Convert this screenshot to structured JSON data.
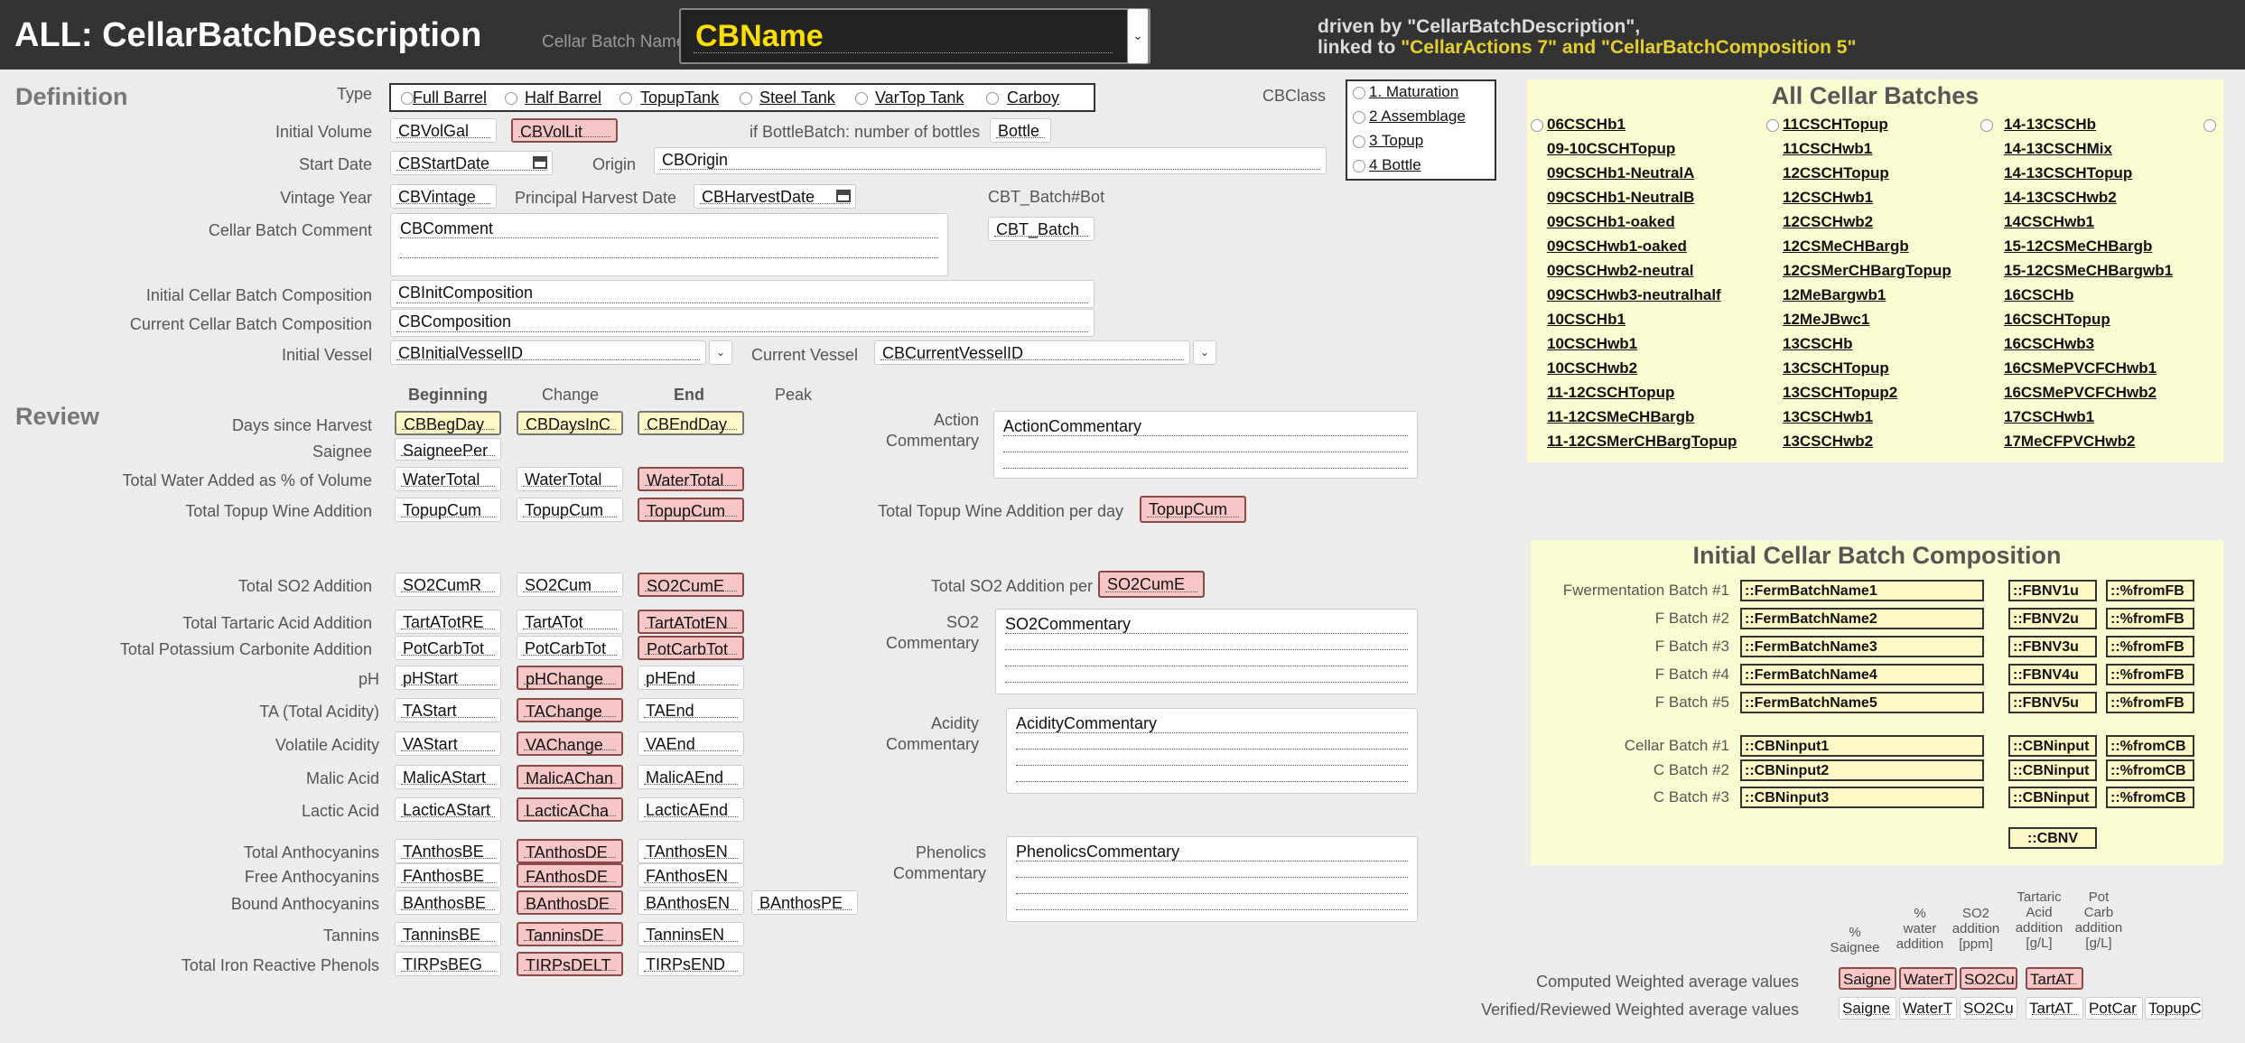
{
  "header": {
    "title": "ALL: CellarBatchDescription",
    "cbname_label": "Cellar Batch Name",
    "cbname_value": "CBName",
    "driven_line1": "driven by \"CellarBatchDescription\",",
    "driven_line2a": "linked to ",
    "driven_line2b": "\"CellarActions 7\" and \"CellarBatchComposition 5\"",
    "dropdown_glyph": "⌄"
  },
  "definition": {
    "section": "Definition",
    "type_label": "Type",
    "type_options": [
      "Full Barrel",
      "Half Barrel",
      "TopupTank",
      "Steel Tank",
      "VarTop Tank",
      "Carboy"
    ],
    "cbclass_label": "CBClass",
    "cbclass_options": [
      "1. Maturation",
      "2 Assemblage",
      "3 Topup",
      "4 Bottle"
    ],
    "initial_volume_label": "Initial Volume",
    "initial_volume_a": "CBVolGal",
    "initial_volume_b": "CBVolLit",
    "bottle_label": "if BottleBatch: number of bottles",
    "bottle_value": "Bottle",
    "start_date_label": "Start Date",
    "start_date": "CBStartDate",
    "origin_label": "Origin",
    "origin": "CBOrigin",
    "vintage_label": "Vintage Year",
    "vintage": "CBVintage",
    "harvest_label": "Principal Harvest Date",
    "harvest": "CBHarvestDate",
    "cbt_label": "CBT_Batch#Bot",
    "cbt_value": "CBT_Batch",
    "comment_label": "Cellar Batch Comment",
    "comment": "CBComment",
    "init_comp_label": "Initial Cellar Batch Composition",
    "init_comp": "CBInitComposition",
    "cur_comp_label": "Current Cellar Batch Composition",
    "cur_comp": "CBComposition",
    "init_vessel_label": "Initial Vessel",
    "init_vessel": "CBInitialVesselID",
    "cur_vessel_label": "Current Vessel",
    "cur_vessel": "CBCurrentVesselID"
  },
  "review": {
    "section": "Review",
    "col_beginning": "Beginning",
    "col_change": "Change",
    "col_end": "End",
    "col_peak": "Peak",
    "days_label": "Days since  Harvest",
    "days_beg": "CBBegDay",
    "days_chg": "CBDaysInC",
    "days_end": "CBEndDay",
    "saignee_label": "Saignee",
    "saignee": "SaigneePer",
    "water_label": "Total Water Added as % of Volume",
    "water_a": "WaterTotal",
    "water_b": "WaterTotal",
    "water_c": "WaterTotal",
    "topup_label": "Total Topup Wine Addition",
    "topup_a": "TopupCum",
    "topup_b": "TopupCum",
    "topup_c": "TopupCum",
    "topup_day_label": "Total Topup Wine Addition per day",
    "topup_day": "TopupCum",
    "action_label_1": "Action",
    "action_label_2": "Commentary",
    "action_comment": "ActionCommentary",
    "so2_label": "Total SO2 Addition",
    "so2_a": "SO2CumR",
    "so2_b": "SO2Cum",
    "so2_c": "SO2CumE",
    "so2_day_label": "Total SO2 Addition per day",
    "so2_day": "SO2CumE",
    "so2c_label_1": "SO2",
    "so2c_label_2": "Commentary",
    "so2_comment": "SO2Commentary",
    "tart_label": "Total Tartaric Acid Addition",
    "tart_a": "TartATotRE",
    "tart_b": "TartATot",
    "tart_c": "TartATotEN",
    "potc_label": "Total Potassium Carbonite Addition",
    "potc_a": "PotCarbTot",
    "potc_b": "PotCarbTot",
    "potc_c": "PotCarbTot",
    "ph_label": "pH",
    "ph_a": "pHStart",
    "ph_b": "pHChange",
    "ph_c": "pHEnd",
    "ta_label": "TA (Total Acidity)",
    "ta_a": "TAStart",
    "ta_b": "TAChange",
    "ta_c": "TAEnd",
    "va_label": "Volatile Acidity",
    "va_a": "VAStart",
    "va_b": "VAChange",
    "va_c": "VAEnd",
    "acid_label_1": "Acidity",
    "acid_label_2": "Commentary",
    "acid_comment": "AcidityCommentary",
    "malic_label": "Malic Acid",
    "malic_a": "MalicAStart",
    "malic_b": "MalicAChan",
    "malic_c": "MalicAEnd",
    "lactic_label": "Lactic Acid",
    "lactic_a": "LacticAStart",
    "lactic_b": "LacticACha",
    "lactic_c": "LacticAEnd",
    "tanth_label": "Total Anthocyanins",
    "tanth_a": "TAnthosBE",
    "tanth_b": "TAnthosDE",
    "tanth_c": "TAnthosEN",
    "fanth_label": "Free Anthocyanins",
    "fanth_a": "FAnthosBE",
    "fanth_b": "FAnthosDE",
    "fanth_c": "FAnthosEN",
    "banth_label": "Bound Anthocyanins",
    "banth_a": "BAnthosBE",
    "banth_b": "BAnthosDE",
    "banth_c": "BAnthosEN",
    "banth_d": "BAnthosPE",
    "tann_label": "Tannins",
    "tann_a": "TanninsBE",
    "tann_b": "TanninsDE",
    "tann_c": "TanninsEN",
    "tirp_label": "Total Iron Reactive Phenols",
    "tirp_a": "TIRPsBEG",
    "tirp_b": "TIRPsDELT",
    "tirp_c": "TIRPsEND",
    "phen_label_1": "Phenolics",
    "phen_label_2": "Commentary",
    "phen_comment": "PhenolicsCommentary"
  },
  "all_batches": {
    "title": "All Cellar Batches",
    "col1": [
      "06CSCHb1",
      "09-10CSCHTopup",
      "09CSCHb1-NeutralA",
      "09CSCHb1-NeutralB",
      "09CSCHb1-oaked",
      "09CSCHwb1-oaked",
      "09CSCHwb2-neutral",
      "09CSCHwb3-neutralhalf",
      "10CSCHb1",
      "10CSCHwb1",
      "10CSCHwb2",
      "11-12CSCHTopup",
      "11-12CSMeCHBargb",
      "11-12CSMerCHBargTopup"
    ],
    "col2": [
      "11CSCHTopup",
      "11CSCHwb1",
      "12CSCHTopup",
      "12CSCHwb1",
      "12CSCHwb2",
      "12CSMeCHBargb",
      "12CSMerCHBargTopup",
      "12MeBargwb1",
      "12MeJBwc1",
      "13CSCHb",
      "13CSCHTopup",
      "13CSCHTopup2",
      "13CSCHwb1",
      "13CSCHwb2"
    ],
    "col3": [
      "14-13CSCHb",
      "14-13CSCHMix",
      "14-13CSCHTopup",
      "14-13CSCHwb2",
      "14CSCHwb1",
      "15-12CSMeCHBargb",
      "15-12CSMeCHBargwb1",
      "16CSCHb",
      "16CSCHTopup",
      "16CSCHwb3",
      "16CSMePVCFCHwb1",
      "16CSMePVCFCHwb2",
      "17CSCHwb1",
      "17MeCFPVCHwb2"
    ]
  },
  "composition": {
    "title": "Initial Cellar Batch Composition",
    "ferm_labels": [
      "Fwermentation Batch #1",
      "F Batch #2",
      "F Batch #3",
      "F Batch #4",
      "F Batch #5"
    ],
    "ferm_names": [
      "::FermBatchName1",
      "::FermBatchName2",
      "::FermBatchName3",
      "::FermBatchName4",
      "::FermBatchName5"
    ],
    "ferm_vols": [
      "::FBNV1u",
      "::FBNV2u",
      "::FBNV3u",
      "::FBNV4u",
      "::FBNV5u"
    ],
    "ferm_pcts": [
      "::%fromFB",
      "::%fromFB",
      "::%fromFB",
      "::%fromFB",
      "::%fromFB"
    ],
    "cb_labels": [
      "Cellar Batch #1",
      "C Batch #2",
      "C Batch #3"
    ],
    "cb_names": [
      "::CBNinput1",
      "::CBNinput2",
      "::CBNinput3"
    ],
    "cb_vols": [
      "::CBNinput",
      "::CBNinput",
      "::CBNinput"
    ],
    "cb_pcts": [
      "::%fromCB",
      "::%fromCB",
      "::%fromCB"
    ],
    "cbnv": "::CBNV"
  },
  "weighted": {
    "heads": [
      "%\nSaignee",
      "%\nwater\naddition",
      "SO2\naddition\n[ppm]",
      "Tartaric\nAcid\naddition\n[g/L]",
      "Pot\nCarb\naddition\n[g/L]"
    ],
    "computed_label": "Computed Weighted average values",
    "computed": [
      "Saigne",
      "WaterT",
      "SO2Cu",
      "TartAT"
    ],
    "verified_label": "Verified/Reviewed Weighted average values",
    "verified": [
      "Saigne",
      "WaterT",
      "SO2Cu",
      "TartAT",
      "PotCar",
      "TopupC"
    ]
  },
  "colors": {
    "header_bg": "#333333",
    "accent_yellow": "#ffde00",
    "panel_bg": "#fcfcd2",
    "change_pink": "#f7c6c6"
  },
  "icons": {
    "calendar": "calendar-icon",
    "dropdown": "chevron-down-icon",
    "radio": "radio-icon"
  }
}
